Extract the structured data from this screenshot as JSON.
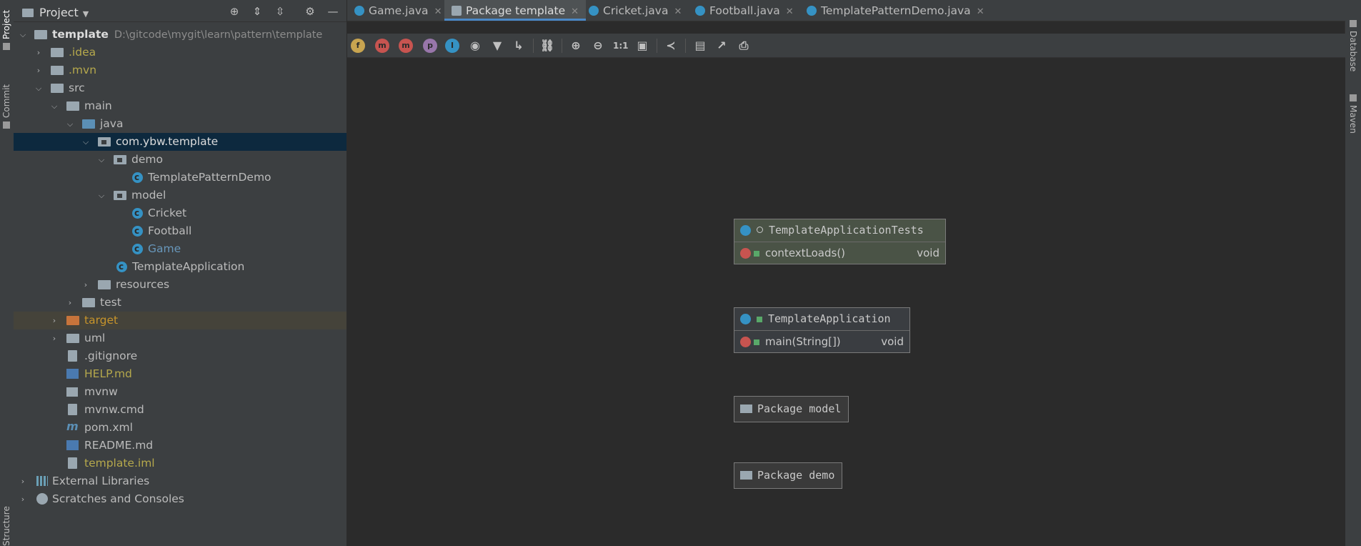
{
  "tool_stripes": {
    "left": {
      "project": "Project",
      "commit": "Commit",
      "structure": "Structure"
    },
    "right": {
      "database": "Database",
      "maven": "Maven"
    }
  },
  "project_panel": {
    "title": "Project",
    "tree": [
      {
        "label": "template",
        "path": "D:\\gitcode\\mygit\\learn\\pattern\\template"
      },
      {
        "label": ".idea"
      },
      {
        "label": ".mvn"
      },
      {
        "label": "src"
      },
      {
        "label": "main"
      },
      {
        "label": "java"
      },
      {
        "label": "com.ybw.template"
      },
      {
        "label": "demo"
      },
      {
        "label": "TemplatePatternDemo"
      },
      {
        "label": "model"
      },
      {
        "label": "Cricket"
      },
      {
        "label": "Football"
      },
      {
        "label": "Game"
      },
      {
        "label": "TemplateApplication"
      },
      {
        "label": "resources"
      },
      {
        "label": "test"
      },
      {
        "label": "target"
      },
      {
        "label": "uml"
      },
      {
        "label": ".gitignore"
      },
      {
        "label": "HELP.md"
      },
      {
        "label": "mvnw"
      },
      {
        "label": "mvnw.cmd"
      },
      {
        "label": "pom.xml"
      },
      {
        "label": "README.md"
      },
      {
        "label": "template.iml"
      },
      {
        "label": "External Libraries"
      },
      {
        "label": "Scratches and Consoles"
      }
    ]
  },
  "tabs": [
    {
      "label": "Game.java",
      "icon": "class-icon"
    },
    {
      "label": "Package template",
      "icon": "diagram-icon",
      "active": true
    },
    {
      "label": "Cricket.java",
      "icon": "class-icon"
    },
    {
      "label": "Football.java",
      "icon": "class-icon"
    },
    {
      "label": "TemplatePatternDemo.java",
      "icon": "class-icon"
    }
  ],
  "diagram_toolbar": {
    "fields": "f",
    "constructors": "m",
    "methods": "m",
    "properties": "p",
    "inner": "I",
    "actual_size": "1:1"
  },
  "diagram": {
    "nodes": [
      {
        "name": "TemplateApplicationTests",
        "member": "contextLoads()",
        "return": "void"
      },
      {
        "name": "TemplateApplication",
        "member": "main(String[])",
        "return": "void"
      }
    ],
    "packages": [
      "Package model",
      "Package demo"
    ]
  },
  "colors": {
    "selection": "#0d293e",
    "accent": "#4a88c7",
    "excluded_highlight": "#45433a"
  }
}
